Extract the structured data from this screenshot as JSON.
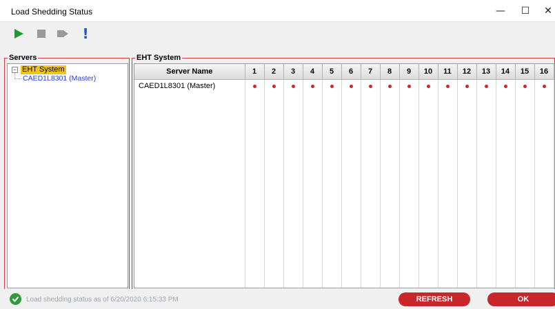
{
  "window": {
    "title": "Load Shedding Status",
    "minimize": "—",
    "maximize": "☐",
    "close": "✕"
  },
  "toolbar": {
    "buttons": [
      {
        "name": "play",
        "icon": "play-icon",
        "color": "#1e9a2c"
      },
      {
        "name": "stop",
        "icon": "stop-icon",
        "color": "#9a9a9a"
      },
      {
        "name": "record",
        "icon": "record-icon",
        "color": "#9a9a9a"
      },
      {
        "name": "alert",
        "icon": "exclamation-icon",
        "color": "#1f4fe0",
        "glyph": "!"
      }
    ]
  },
  "servers_panel": {
    "label": "Servers",
    "tree": {
      "expander": "−",
      "root": "EHT System",
      "children": [
        "CAED1L8301 (Master)"
      ]
    }
  },
  "system_panel": {
    "label": "EHT System",
    "columns": [
      "Server Name",
      "1",
      "2",
      "3",
      "4",
      "5",
      "6",
      "7",
      "8",
      "9",
      "10",
      "11",
      "12",
      "13",
      "14",
      "15",
      "16"
    ],
    "rows": [
      {
        "name": "CAED1L8301 (Master)",
        "status_color": "#e02020"
      }
    ]
  },
  "status": {
    "text": "Load shedding status as of 6/20/2020 6:15:33 PM",
    "icon": "check-circle-icon",
    "color": "#2e9a3c"
  },
  "actions": {
    "refresh": "REFRESH",
    "ok": "OK",
    "color": "#c8262b"
  }
}
